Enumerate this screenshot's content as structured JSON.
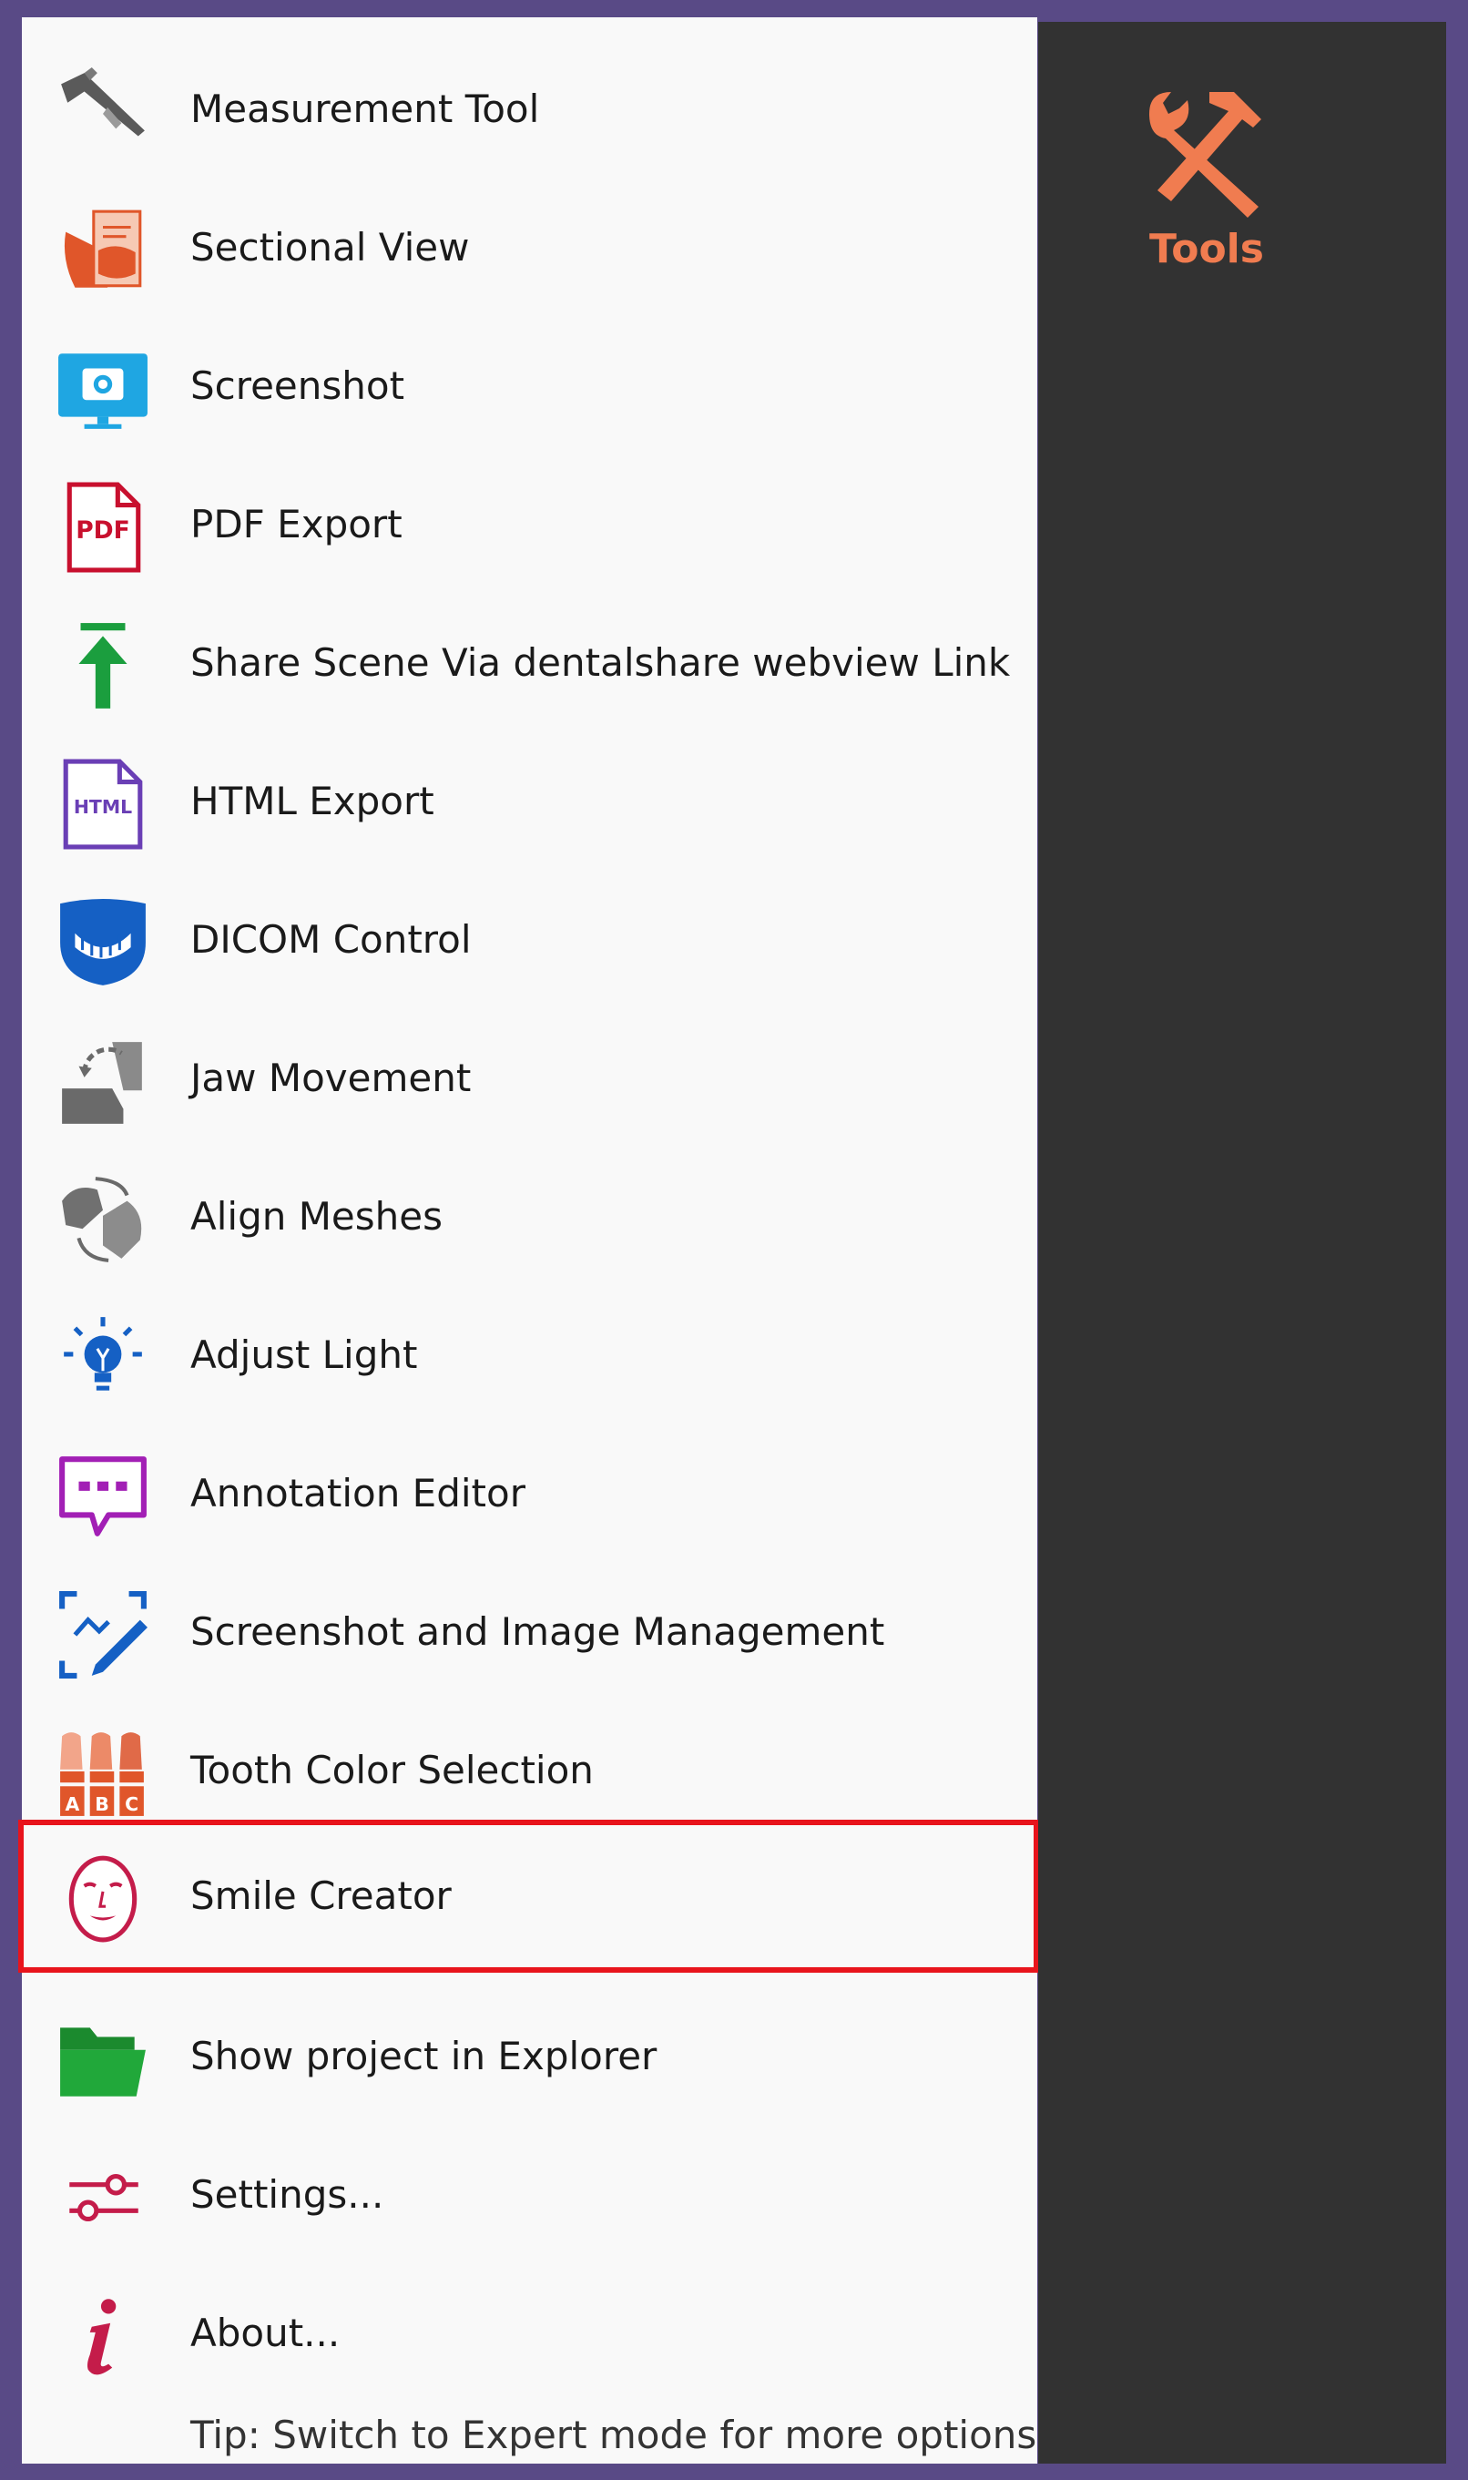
{
  "menu": {
    "items": [
      {
        "id": "measurement",
        "label": "Measurement Tool",
        "icon": "caliper-icon"
      },
      {
        "id": "sectional",
        "label": "Sectional View",
        "icon": "sectional-view-icon"
      },
      {
        "id": "screenshot",
        "label": "Screenshot",
        "icon": "camera-monitor-icon"
      },
      {
        "id": "pdf",
        "label": "PDF Export",
        "icon": "pdf-file-icon"
      },
      {
        "id": "share",
        "label": "Share Scene Via dentalshare webview Link",
        "icon": "upload-arrow-icon"
      },
      {
        "id": "html",
        "label": "HTML Export",
        "icon": "html-file-icon"
      },
      {
        "id": "dicom",
        "label": "DICOM Control",
        "icon": "jaw-shield-icon"
      },
      {
        "id": "jaw",
        "label": "Jaw Movement",
        "icon": "jaw-movement-icon"
      },
      {
        "id": "align",
        "label": "Align Meshes",
        "icon": "align-meshes-icon"
      },
      {
        "id": "light",
        "label": "Adjust Light",
        "icon": "lightbulb-icon"
      },
      {
        "id": "annotation",
        "label": "Annotation Editor",
        "icon": "speech-bubble-icon"
      },
      {
        "id": "image-mgmt",
        "label": "Screenshot and Image Management",
        "icon": "image-edit-icon"
      },
      {
        "id": "tooth-color",
        "label": "Tooth Color Selection",
        "icon": "tooth-shade-icon",
        "shade_letters": [
          "A",
          "B",
          "C"
        ]
      },
      {
        "id": "smile",
        "label": "Smile Creator",
        "icon": "face-icon",
        "highlighted": true
      },
      {
        "id": "explorer",
        "label": "Show project in Explorer",
        "icon": "folder-icon"
      },
      {
        "id": "settings",
        "label": "Settings...",
        "icon": "sliders-icon"
      },
      {
        "id": "about",
        "label": "About...",
        "icon": "info-icon"
      }
    ],
    "tip": "Tip: Switch to Expert mode for more options"
  },
  "tools": {
    "label": "Tools",
    "icon": "hammer-wrench-icon",
    "accent": "#f07c50"
  },
  "colors": {
    "highlight_border": "#e8141c",
    "panel_bg": "#f9f9f9",
    "sidebar_bg": "#323232",
    "frame_bg": "#594a86"
  }
}
